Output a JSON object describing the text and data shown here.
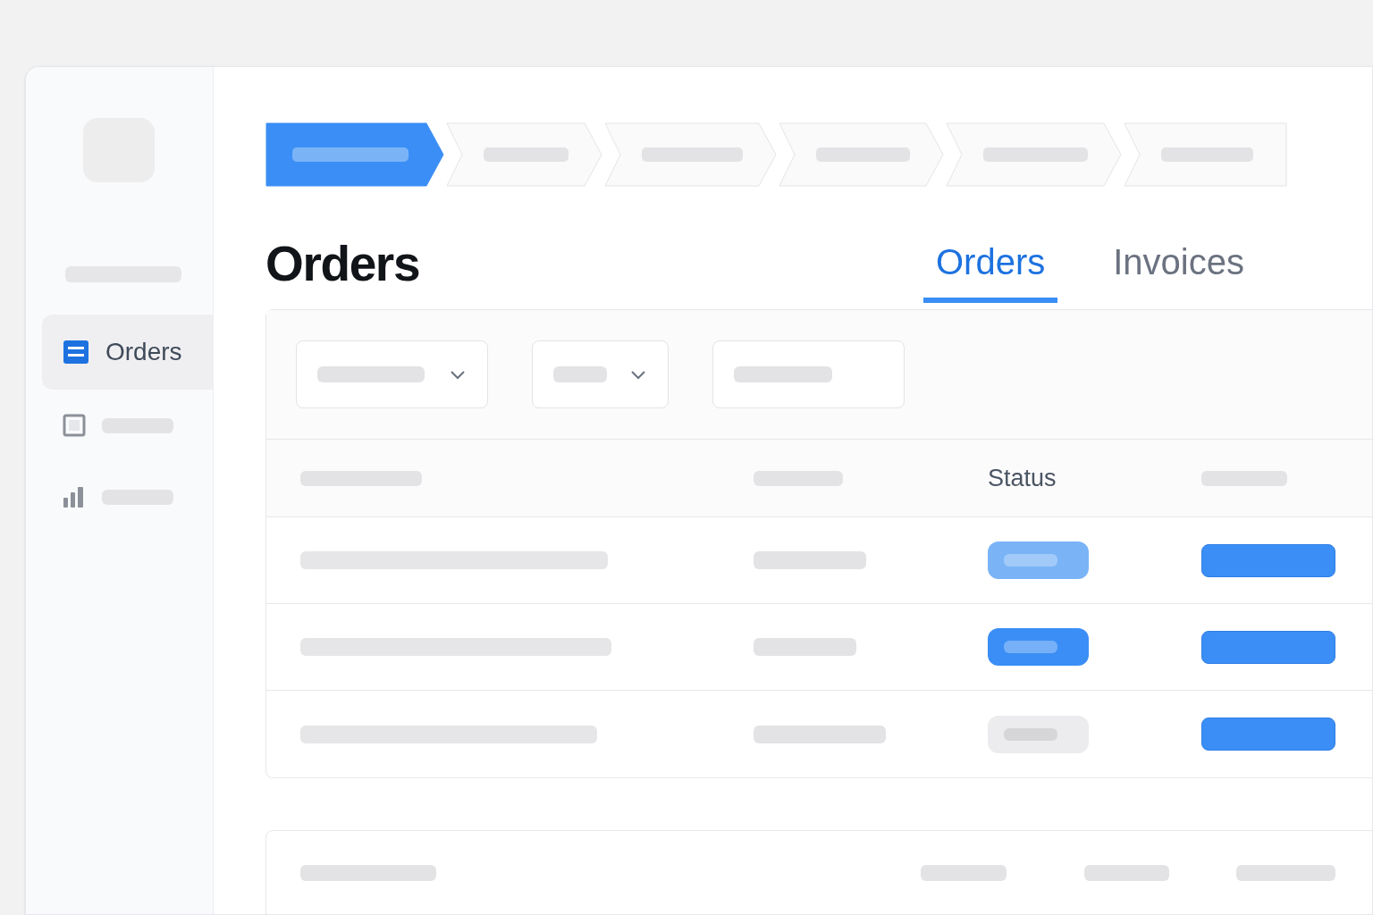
{
  "steps": [
    {
      "selected": true
    },
    {
      "selected": false
    },
    {
      "selected": false
    },
    {
      "selected": false
    },
    {
      "selected": false
    },
    {
      "selected": false
    }
  ],
  "sidebar": {
    "items": [
      {
        "label": "Orders",
        "selected": true
      },
      {
        "selected": false
      },
      {
        "selected": false
      }
    ]
  },
  "page_title": "Orders",
  "tabs": [
    {
      "label": "Orders",
      "selected": true
    },
    {
      "label": "Invoices",
      "selected": false
    }
  ],
  "table": {
    "status_heading": "Status",
    "rows": [
      {
        "color": "#7ab4f7"
      },
      {
        "color": "#3b8ef5"
      },
      {
        "color": "#ececee"
      }
    ]
  }
}
